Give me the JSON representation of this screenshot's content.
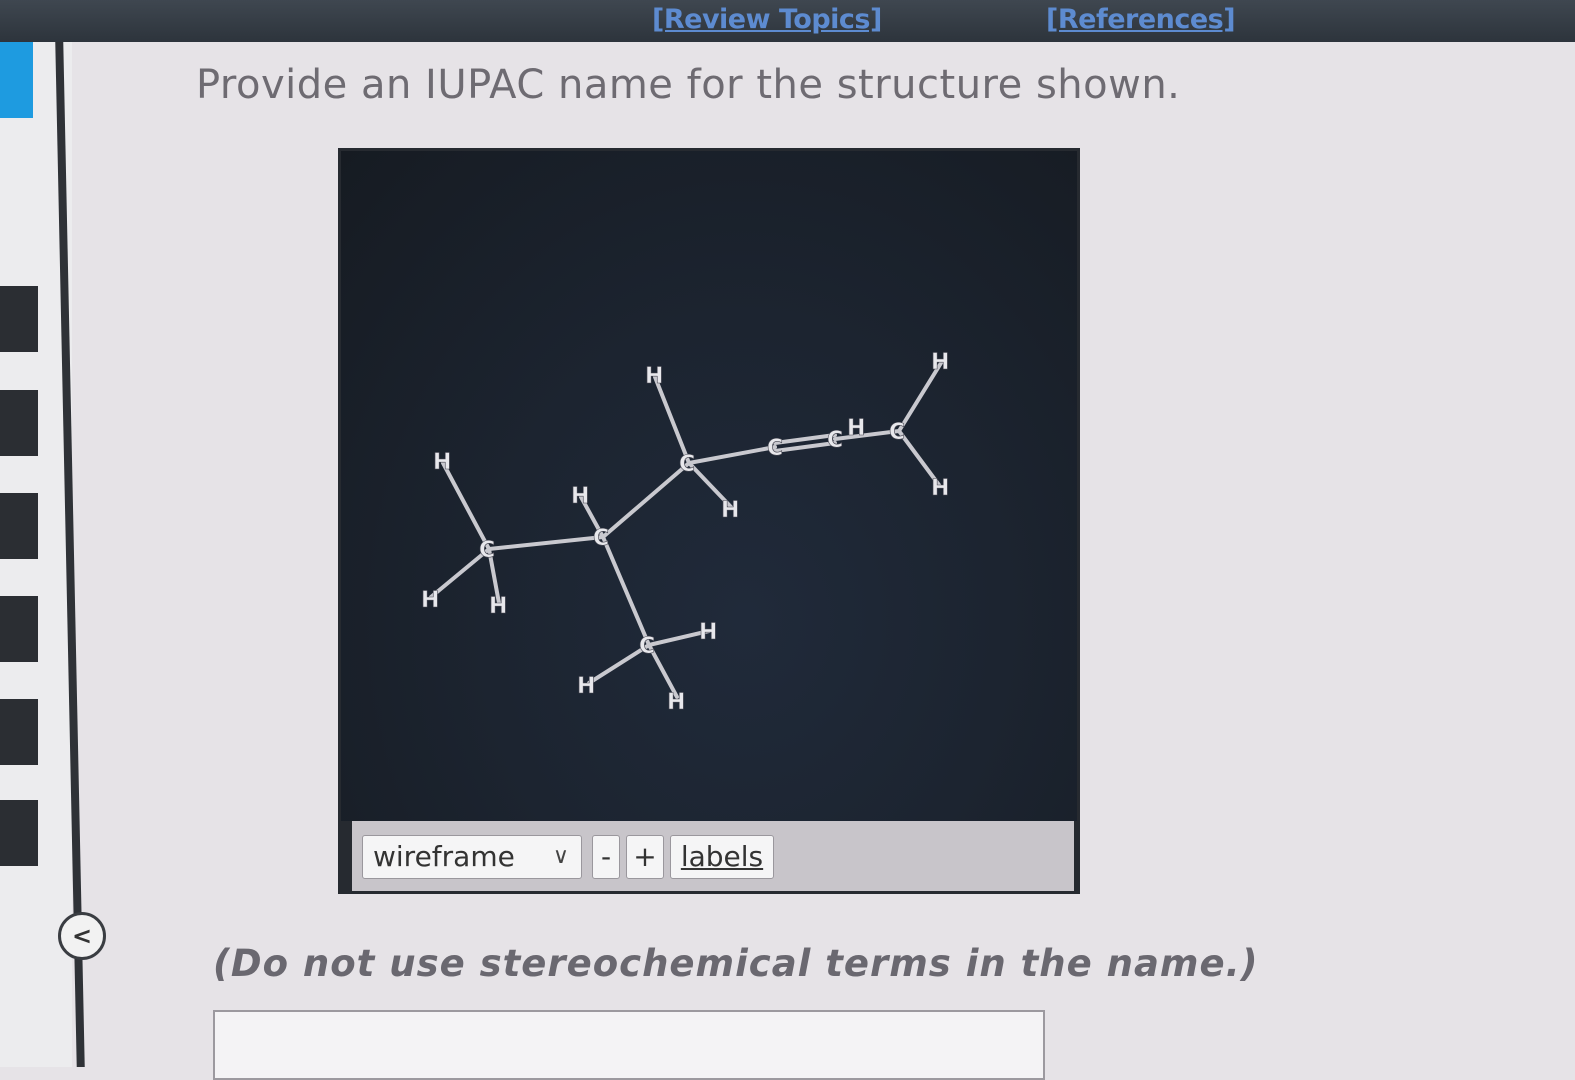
{
  "top_links": {
    "review_topics": "[Review Topics]",
    "references": "[References]"
  },
  "question": {
    "prompt": "Provide an IUPAC name for the structure shown.",
    "instruction": "(Do not use stereochemical terms in the name.)",
    "answer_value": ""
  },
  "viewer": {
    "render_mode": "wireframe",
    "minus_label": "-",
    "plus_label": "+",
    "labels_label": "labels",
    "atoms": {
      "h_a": "H",
      "h_b": "H",
      "h_c": "H",
      "c1": "C",
      "h_d": "H",
      "c2": "C",
      "h_e": "H",
      "c3": "C",
      "h_f": "H",
      "h_g": "H",
      "c4": "C",
      "h_h": "H",
      "c5": "C",
      "c6": "C",
      "h_i": "H",
      "c7": "C",
      "h_j": "H",
      "h_k": "H"
    }
  },
  "colors": {
    "accent_blue": "#1e9be0",
    "link_blue": "#5d8bd0",
    "viewer_bg": "#1c2430"
  },
  "icons": {
    "collapse": "chevron-left-icon",
    "select": "chevron-down-icon"
  },
  "collapse_glyph": "<"
}
